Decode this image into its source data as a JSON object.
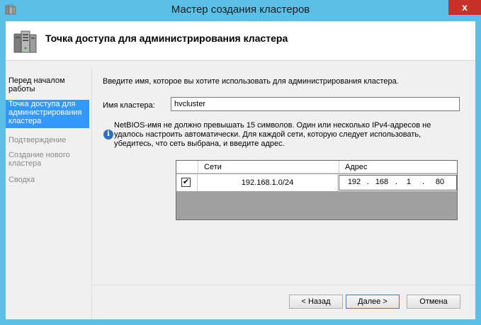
{
  "window": {
    "title": "Мастер создания кластеров",
    "close_glyph": "x"
  },
  "header": {
    "title": "Точка доступа для администрирования кластера",
    "icon": "server-cluster-icon"
  },
  "sidebar": {
    "items": [
      {
        "label": "Перед началом\nработы",
        "state": "normal"
      },
      {
        "label": "Точка доступа для\nадминистрирования\nкластера",
        "state": "active"
      },
      {
        "label": "Подтверждение",
        "state": "disabled"
      },
      {
        "label": "Создание нового\nкластера",
        "state": "disabled"
      },
      {
        "label": "Сводка",
        "state": "disabled"
      }
    ]
  },
  "main": {
    "intro": "Введите имя, которое вы хотите использовать для администрирования кластера.",
    "cluster_name_label": "Имя кластера:",
    "cluster_name_value": "hvcluster",
    "info_text": "NetBIOS-имя не должно превышать 15 символов.  Один или несколько IPv4-адресов не удалось настроить автоматически.  Для каждой сети, которую следует использовать, убедитесь, что сеть выбрана, и введите адрес.",
    "grid": {
      "columns": [
        "Сети",
        "Адрес"
      ],
      "rows": [
        {
          "checked": true,
          "check_glyph": "✔",
          "network": "192.168.1.0/24",
          "octets": [
            "192",
            "168",
            "1",
            "80"
          ]
        }
      ]
    }
  },
  "footer": {
    "back_label": "< Назад",
    "next_label": "Далее >",
    "cancel_label": "Отмена"
  },
  "colors": {
    "frame": "#5bc0e8",
    "selection": "#3399ff",
    "close": "#c7312a"
  }
}
